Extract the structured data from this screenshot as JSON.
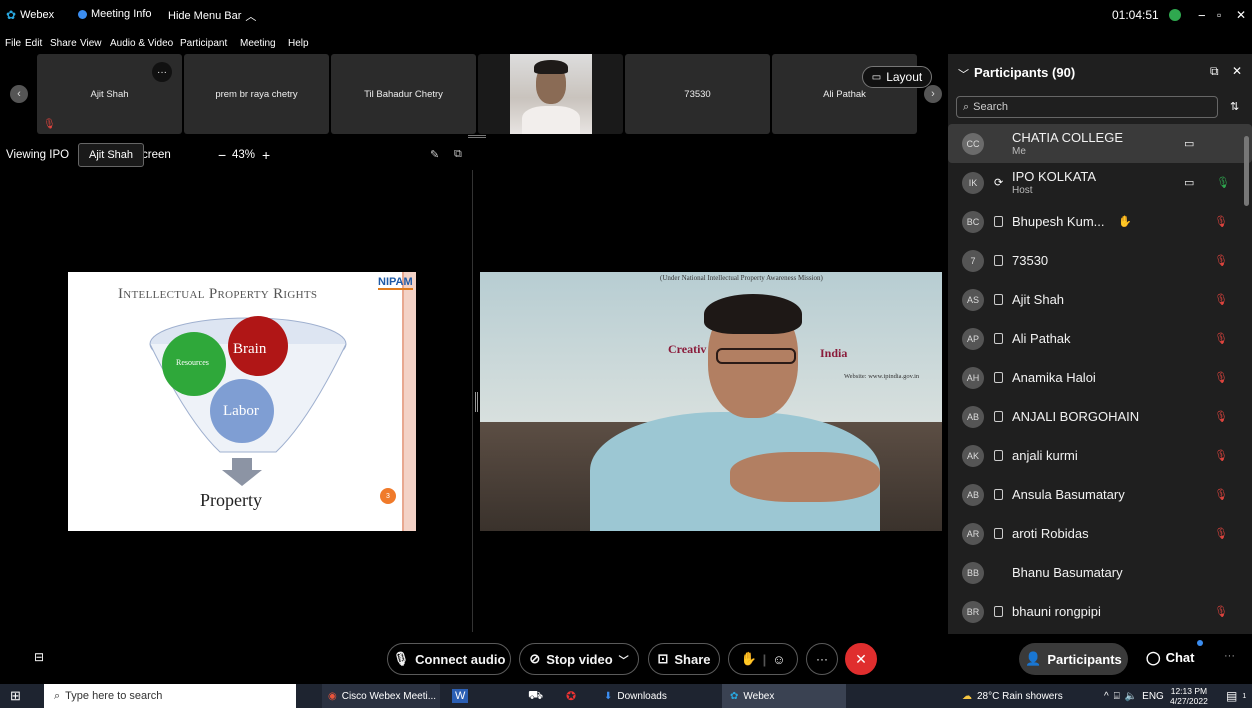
{
  "titlebar": {
    "app": "Webex",
    "meeting_info": "Meeting Info",
    "hide_menu": "Hide Menu Bar",
    "clock": "01:04:51"
  },
  "menu": [
    "File",
    "Edit",
    "Share",
    "View",
    "Audio & Video",
    "Participant",
    "Meeting",
    "Help"
  ],
  "thumbnails": [
    "Ajit Shah",
    "prem br raya chetry",
    "Til Bahadur Chetry",
    "",
    "73530",
    "Ali Pathak"
  ],
  "layout_label": "Layout",
  "viewbar": {
    "viewing": "Viewing IPO",
    "screen_suffix": "creen",
    "tooltip": "Ajit Shah",
    "zoom": "43%",
    "minus": "−",
    "plus": "+"
  },
  "slide": {
    "title": "Intellectual Property Rights",
    "logo": "NIPAM",
    "brain": "Brain",
    "resources": "Resources",
    "labor": "Labor",
    "property": "Property",
    "badge": "3"
  },
  "video": {
    "banner": "(Under National Intellectual Property Awareness Mission)",
    "creative": "Creativ",
    "india": "India",
    "website": "Website: www.ipindia.gov.in"
  },
  "panel": {
    "title": "Participants (90)",
    "search_placeholder": "Search",
    "participants": [
      {
        "initials": "CC",
        "name": "CHATIA COLLEGE",
        "role": "Me"
      },
      {
        "initials": "IK",
        "name": "IPO KOLKATA",
        "role": "Host"
      },
      {
        "initials": "BC",
        "name": "Bhupesh Kum...",
        "role": ""
      },
      {
        "initials": "7",
        "name": "73530",
        "role": ""
      },
      {
        "initials": "AS",
        "name": "Ajit Shah",
        "role": ""
      },
      {
        "initials": "AP",
        "name": "Ali Pathak",
        "role": ""
      },
      {
        "initials": "AH",
        "name": "Anamika Haloi",
        "role": ""
      },
      {
        "initials": "AB",
        "name": "ANJALI BORGOHAIN",
        "role": ""
      },
      {
        "initials": "AK",
        "name": "anjali kurmi",
        "role": ""
      },
      {
        "initials": "AB",
        "name": "Ansula Basumatary",
        "role": ""
      },
      {
        "initials": "AR",
        "name": "aroti Robidas",
        "role": ""
      },
      {
        "initials": "BB",
        "name": "Bhanu Basumatary",
        "role": ""
      },
      {
        "initials": "BR",
        "name": "bhauni rongpipi",
        "role": ""
      }
    ]
  },
  "controls": {
    "connect_audio": "Connect audio",
    "stop_video": "Stop video",
    "share": "Share",
    "participants": "Participants",
    "chat": "Chat",
    "more": "···"
  },
  "taskbar": {
    "search": "Type here to search",
    "webex_task": "Cisco Webex Meeti...",
    "downloads": "Downloads",
    "webex": "Webex",
    "weather": "28°C  Rain showers",
    "lang": "ENG",
    "time": "12:13 PM",
    "date": "4/27/2022",
    "notif": "1"
  },
  "colors": {
    "accent_green": "#2fa84f",
    "end_red": "#e02e2e",
    "panel_bg": "#1f1f1f"
  }
}
